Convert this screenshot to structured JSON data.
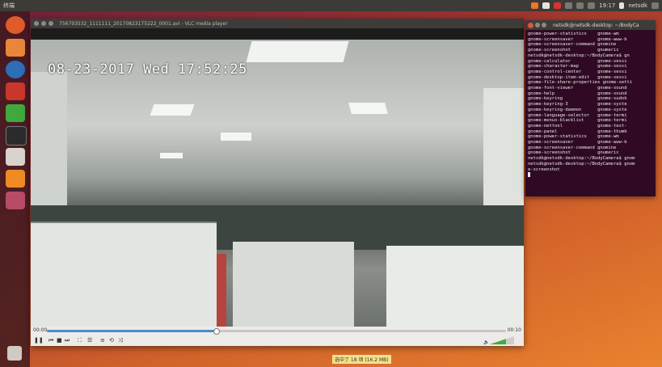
{
  "top_panel": {
    "left_text": "终端",
    "time": "19:17",
    "user": "netsdk"
  },
  "vlc": {
    "title": "756793532_1111111_20170823175222_0001.avi - VLC media player",
    "osd_timestamp": "08-23-2017 Wed 17:52:25",
    "time_elapsed": "00:00",
    "time_total": "00:10",
    "progress": 0.37
  },
  "terminal": {
    "title": "netsdk@netsdk-desktop: ~/BodyCa",
    "lines": [
      "gnome-power-statistics    gnome-wm",
      "gnome-screensaver         gnome-www-b",
      "gnome-screensaver-command gnomine",
      "gnome-screenshot          gnumeric",
      "netsdk@netsdk-desktop:~/BodyCamera$ gn",
      "gnome-calculator          gnome-sessi",
      "gnome-character-map       gnome-sessi",
      "gnome-control-center      gnome-sessi",
      "gnome-desktop-item-edit   gnome-sessi",
      "gnome-file-share-properties gnome-setti",
      "gnome-font-viewer         gnome-sound",
      "gnome-help                gnome-sound",
      "gnome-keyring             gnome-sudok",
      "gnome-keyring-3           gnome-syste",
      "gnome-keyring-daemon      gnome-syste",
      "gnome-language-selector   gnome-termi",
      "gnome-menus-blacklist     gnome-termi",
      "gnome-nettool             gnome-text-",
      "gnome-panel               gnome-thumb",
      "gnome-power-statistics    gnome-wm",
      "gnome-screensaver         gnome-www-b",
      "gnome-screensaver-command gnomine",
      "gnome-screenshot          gnumeric",
      "netsdk@netsdk-desktop:~/BodyCamera$ gnom",
      "netsdk@netsdk-desktop:~/BodyCamera$ gnom",
      "e-screenshot"
    ]
  },
  "status_tip": "选中了 18 项 (16.2 MB)",
  "colors": {
    "accent": "#4b8ad0",
    "terminal_bg": "#300a24",
    "panel": "#3c3b37"
  }
}
